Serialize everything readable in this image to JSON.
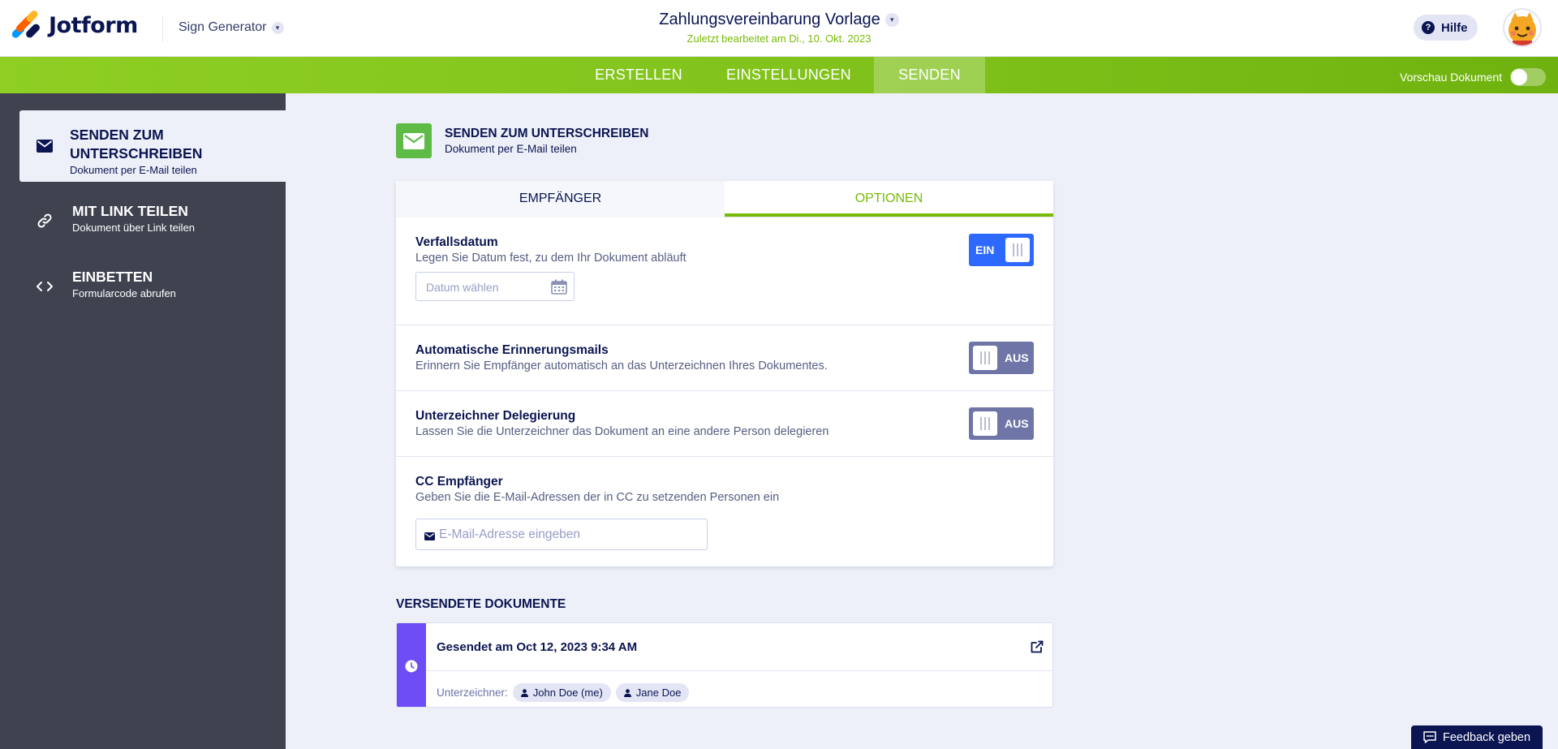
{
  "header": {
    "logo_text": "Jotform",
    "product_name": "Sign Generator",
    "doc_title": "Zahlungsvereinbarung Vorlage",
    "doc_subtitle": "Zuletzt bearbeitet am Di., 10. Okt. 2023",
    "help_label": "Hilfe"
  },
  "nav": {
    "tabs": [
      {
        "label": "ERSTELLEN",
        "active": false
      },
      {
        "label": "EINSTELLUNGEN",
        "active": false
      },
      {
        "label": "SENDEN",
        "active": true
      }
    ],
    "preview_label": "Vorschau Dokument",
    "preview_on": false
  },
  "sidebar": {
    "items": [
      {
        "title": "SENDEN ZUM UNTERSCHREIBEN",
        "description": "Dokument per E-Mail teilen",
        "icon": "envelope-icon",
        "active": true
      },
      {
        "title": "MIT LINK TEILEN",
        "description": "Dokument über Link teilen",
        "icon": "link-icon",
        "active": false
      },
      {
        "title": "EINBETTEN",
        "description": "Formularcode abrufen",
        "icon": "code-icon",
        "active": false
      }
    ]
  },
  "main": {
    "title": "SENDEN ZUM UNTERSCHREIBEN",
    "description": "Dokument per E-Mail teilen",
    "tabs": [
      {
        "label": "EMPFÄNGER",
        "active": false
      },
      {
        "label": "OPTIONEN",
        "active": true
      }
    ],
    "options": {
      "expiry": {
        "title": "Verfallsdatum",
        "description": "Legen Sie Datum fest, zu dem Ihr Dokument abläuft",
        "toggle_label": "EIN",
        "enabled": true,
        "date_placeholder": "Datum wählen"
      },
      "reminders": {
        "title": "Automatische Erinnerungsmails",
        "description": "Erinnern Sie Empfänger automatisch an das Unterzeichnen Ihres Dokumentes.",
        "toggle_label": "AUS",
        "enabled": false
      },
      "delegation": {
        "title": "Unterzeichner Delegierung",
        "description": "Lassen Sie die Unterzeichner das Dokument an eine andere Person delegieren",
        "toggle_label": "AUS",
        "enabled": false
      },
      "cc": {
        "title": "CC Empfänger",
        "description": "Geben Sie die E-Mail-Adressen der in CC zu setzenden Personen ein",
        "email_placeholder": "E-Mail-Adresse eingeben",
        "email_value": ""
      }
    },
    "sent": {
      "heading": "VERSENDETE DOKUMENTE",
      "item": {
        "date_label": "Gesendet am Oct 12, 2023 9:34 AM",
        "signers_label": "Unterzeichner:",
        "signers": [
          "John Doe (me)",
          "Jane Doe"
        ]
      }
    }
  },
  "feedback_label": "Feedback geben",
  "colors": {
    "brand_green": "#78bb07",
    "sidebar_bg": "#3f4350",
    "navy": "#0a1551",
    "toggle_on": "#2e69ff",
    "toggle_off": "#6f76a7",
    "sent_strip": "#6f4df6"
  }
}
